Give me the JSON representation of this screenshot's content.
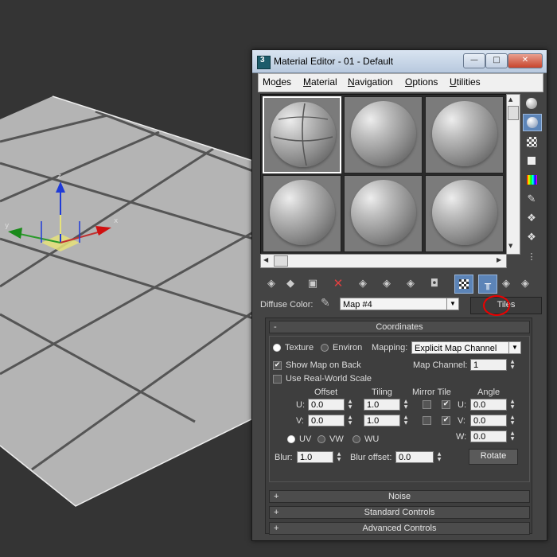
{
  "window": {
    "title": "Material Editor - 01 - Default",
    "app_icon": "3ds-max-logo-icon",
    "buttons": {
      "minimize": "—",
      "maximize": "□",
      "close": "✕"
    }
  },
  "menu": [
    {
      "label": "Modes",
      "underline": "d",
      "pre": "Mo",
      "post": "es"
    },
    {
      "label": "Material",
      "underline": "M",
      "pre": "",
      "post": "aterial"
    },
    {
      "label": "Navigation",
      "underline": "N",
      "pre": "",
      "post": "avigation"
    },
    {
      "label": "Options",
      "underline": "O",
      "pre": "",
      "post": "ptions"
    },
    {
      "label": "Utilities",
      "underline": "U",
      "pre": "",
      "post": "tilities"
    }
  ],
  "sample_slots": [
    "slot-1-active",
    "slot-2",
    "slot-3",
    "slot-4",
    "slot-5",
    "slot-6"
  ],
  "diffuse": {
    "label": "Diffuse Color:",
    "map_name": "Map #4",
    "map_type": "Tiles"
  },
  "coordinates": {
    "header": "Coordinates",
    "header_sign": "-",
    "texture_label": "Texture",
    "environ_label": "Environ",
    "mapping_label": "Mapping:",
    "mapping_value": "Explicit Map Channel",
    "show_map_on_back": "Show Map on Back",
    "use_real_world_scale": "Use Real-World Scale",
    "map_channel_label": "Map Channel:",
    "map_channel_value": "1",
    "col_offset": "Offset",
    "col_tiling": "Tiling",
    "col_mirror_tile": "Mirror Tile",
    "col_angle": "Angle",
    "u_label": "U:",
    "v_label": "V:",
    "w_label": "W:",
    "u_offset": "0.0",
    "v_offset": "0.0",
    "u_tiling": "1.0",
    "v_tiling": "1.0",
    "u_angle": "0.0",
    "v_angle": "0.0",
    "w_angle": "0.0",
    "uv_label": "UV",
    "vw_label": "VW",
    "wu_label": "WU",
    "blur_label": "Blur:",
    "blur_value": "1.0",
    "blur_offset_label": "Blur offset:",
    "blur_offset_value": "0.0",
    "rotate_button": "Rotate",
    "check_mark": "✔"
  },
  "rollouts": [
    {
      "sign": "+",
      "label": "Noise"
    },
    {
      "sign": "+",
      "label": "Standard Controls"
    },
    {
      "sign": "+",
      "label": "Advanced Controls"
    }
  ],
  "gizmo": {
    "x": "x",
    "y": "y",
    "z": "z"
  },
  "colors": {
    "highlight": "#e00000",
    "selected_tool": "#5c84b7"
  }
}
